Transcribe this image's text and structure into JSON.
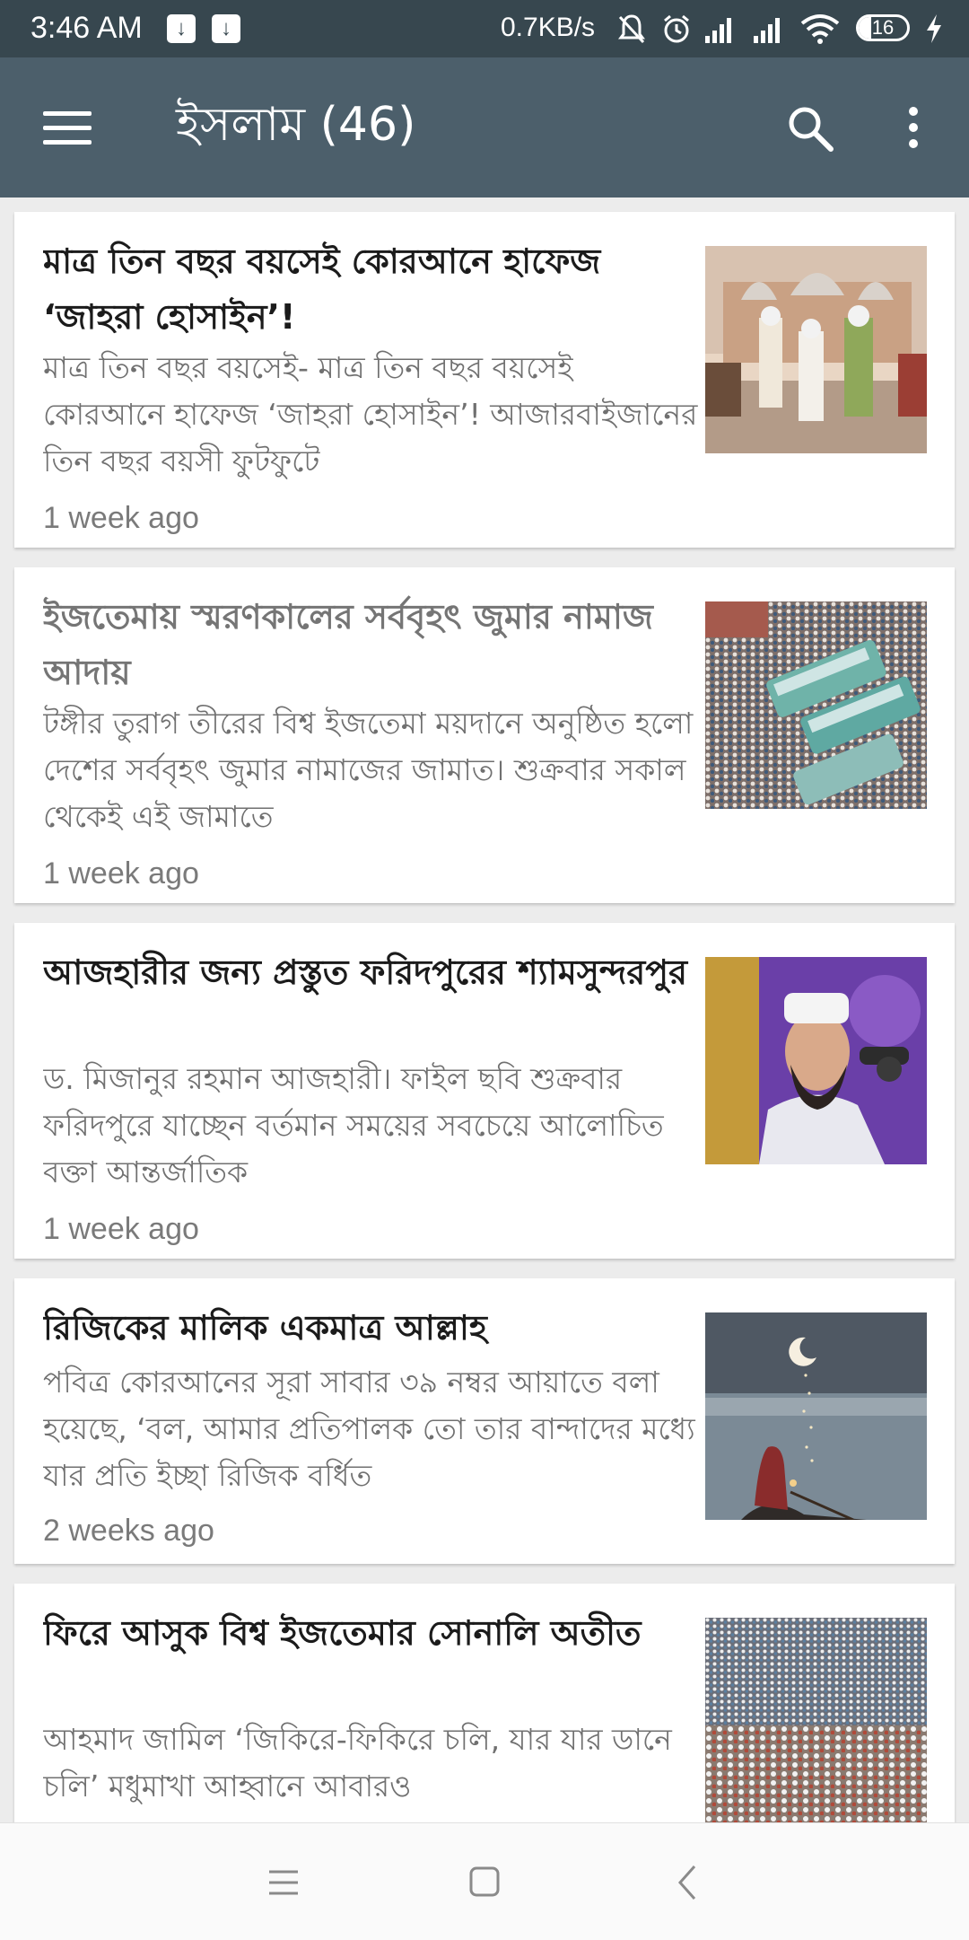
{
  "status_bar": {
    "time": "3:46 AM",
    "network_speed": "0.7KB/s",
    "battery_level": "16",
    "icons": [
      "download-icon",
      "download-icon",
      "mute-icon",
      "alarm-icon",
      "signal-icon",
      "signal-icon",
      "wifi-icon",
      "charging-icon"
    ]
  },
  "app_bar": {
    "title": "ইসলাম (46)",
    "background_color": "#4c5f6b",
    "icons": [
      "menu-icon",
      "search-icon",
      "more-vert-icon"
    ]
  },
  "articles": [
    {
      "headline": "মাত্র তিন বছর বয়সেই কোরআনে হাফেজ ‘জাহরা হোসাইন’!",
      "excerpt": "মাত্র তিন বছর বয়সেই- মাত্র তিন বছর বয়সেই কোরআনে হাফেজ ‘জাহরা হোসাইন’! আজারবাইজানের তিন বছর বয়সী ফুটফুটে",
      "time_ago": "1 week ago",
      "read": false
    },
    {
      "headline": "ইজতেমায় স্মরণকালের সর্ববৃহৎ জুমার নামাজ আদায়",
      "excerpt": "টঙ্গীর তুরাগ তীরের বিশ্ব ইজতেমা ময়দানে অনুষ্ঠিত হলো দেশের সর্ববৃহৎ জুমার নামাজের জামাত। শুক্রবার সকাল থেকেই এই জামাতে",
      "time_ago": "1 week ago",
      "read": true
    },
    {
      "headline": "আজহারীর জন্য প্রস্তুত ফরিদপুরের শ্যামসুন্দরপুর",
      "excerpt": "ড. মিজানুর রহমান আজহারী। ফাইল ছবি শুক্রবার ফরিদপুরে যাচ্ছেন বর্তমান সময়ের সবচেয়ে আলোচিত বক্তা আন্তর্জাতিক",
      "time_ago": "1 week ago",
      "read": false
    },
    {
      "headline": "রিজিকের মালিক একমাত্র আল্লাহ",
      "excerpt": "পবিত্র কোরআনের সূরা সাবার ৩৯ নম্বর আয়াতে বলা হয়েছে, ‘বল, আমার প্রতিপালক তো তার বান্দাদের মধ্যে যার প্রতি ইচ্ছা রিজিক বর্ধিত",
      "time_ago": "2 weeks ago",
      "read": false
    },
    {
      "headline": "ফিরে আসুক বিশ্ব ইজতেমার সোনালি অতীত",
      "excerpt": "আহমাদ জামিল ‘জিকিরে-ফিকিরে চলি, যার যার ডানে চলি’ মধুমাখা আহ্বানে আবারও",
      "time_ago": "",
      "read": false
    }
  ],
  "nav_bar": {
    "icons": [
      "recents-icon",
      "home-icon",
      "back-icon"
    ]
  }
}
